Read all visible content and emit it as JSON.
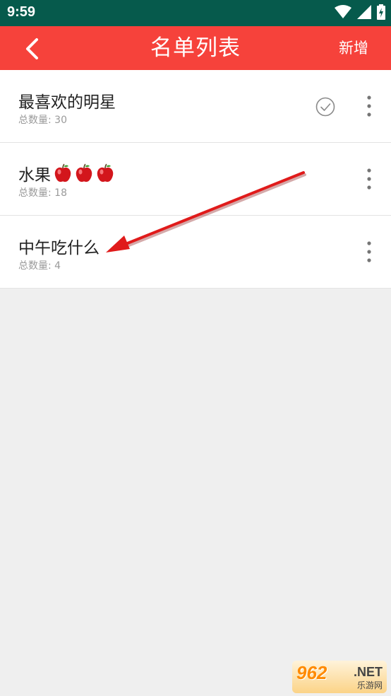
{
  "status_bar": {
    "time": "9:59",
    "icons": [
      "wifi-icon",
      "signal-icon",
      "battery-icon"
    ]
  },
  "app_bar": {
    "back_icon": "back-chevron-icon",
    "title": "名单列表",
    "add_label": "新增"
  },
  "lists": [
    {
      "title": "最喜欢的明星",
      "count_label": "总数量: 30",
      "checked": true
    },
    {
      "title": "水果",
      "count_label": "总数量: 18",
      "emoji": "🍎🍎🍎",
      "checked": false
    },
    {
      "title": "中午吃什么",
      "count_label": "总数量: 4",
      "checked": false
    }
  ],
  "watermark": {
    "brand": "962",
    "suffix": ".NET",
    "site_name": "乐游网"
  },
  "colors": {
    "status_bar": "#065a4c",
    "app_bar": "#f6423b",
    "background": "#efefef",
    "arrow": "#e01b1b"
  }
}
